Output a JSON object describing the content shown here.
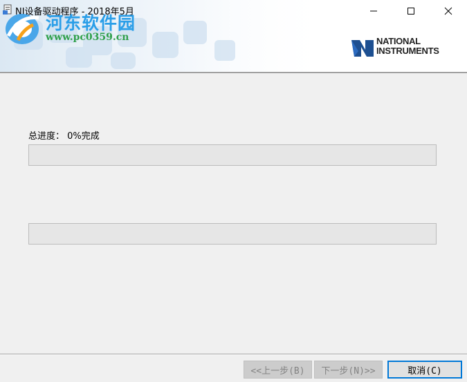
{
  "window": {
    "title": "NI设备驱动程序 - 2018年5月"
  },
  "watermark": {
    "site_name": "河东软件园",
    "url": "www.pc0359.cn"
  },
  "brand": {
    "line1": "NATIONAL",
    "line2": "INSTRUMENTS"
  },
  "progress": {
    "overall_label": "总进度： 0%完成",
    "overall_value": 0,
    "detail_value": 0
  },
  "buttons": {
    "back": "<<上一步(B)",
    "next": "下一步(N)>>",
    "cancel": "取消(C)"
  },
  "colors": {
    "accent": "#0078d7",
    "progress_fill": "#06b025",
    "watermark_blue": "#2a9ee8",
    "watermark_green": "#2fa04a"
  }
}
